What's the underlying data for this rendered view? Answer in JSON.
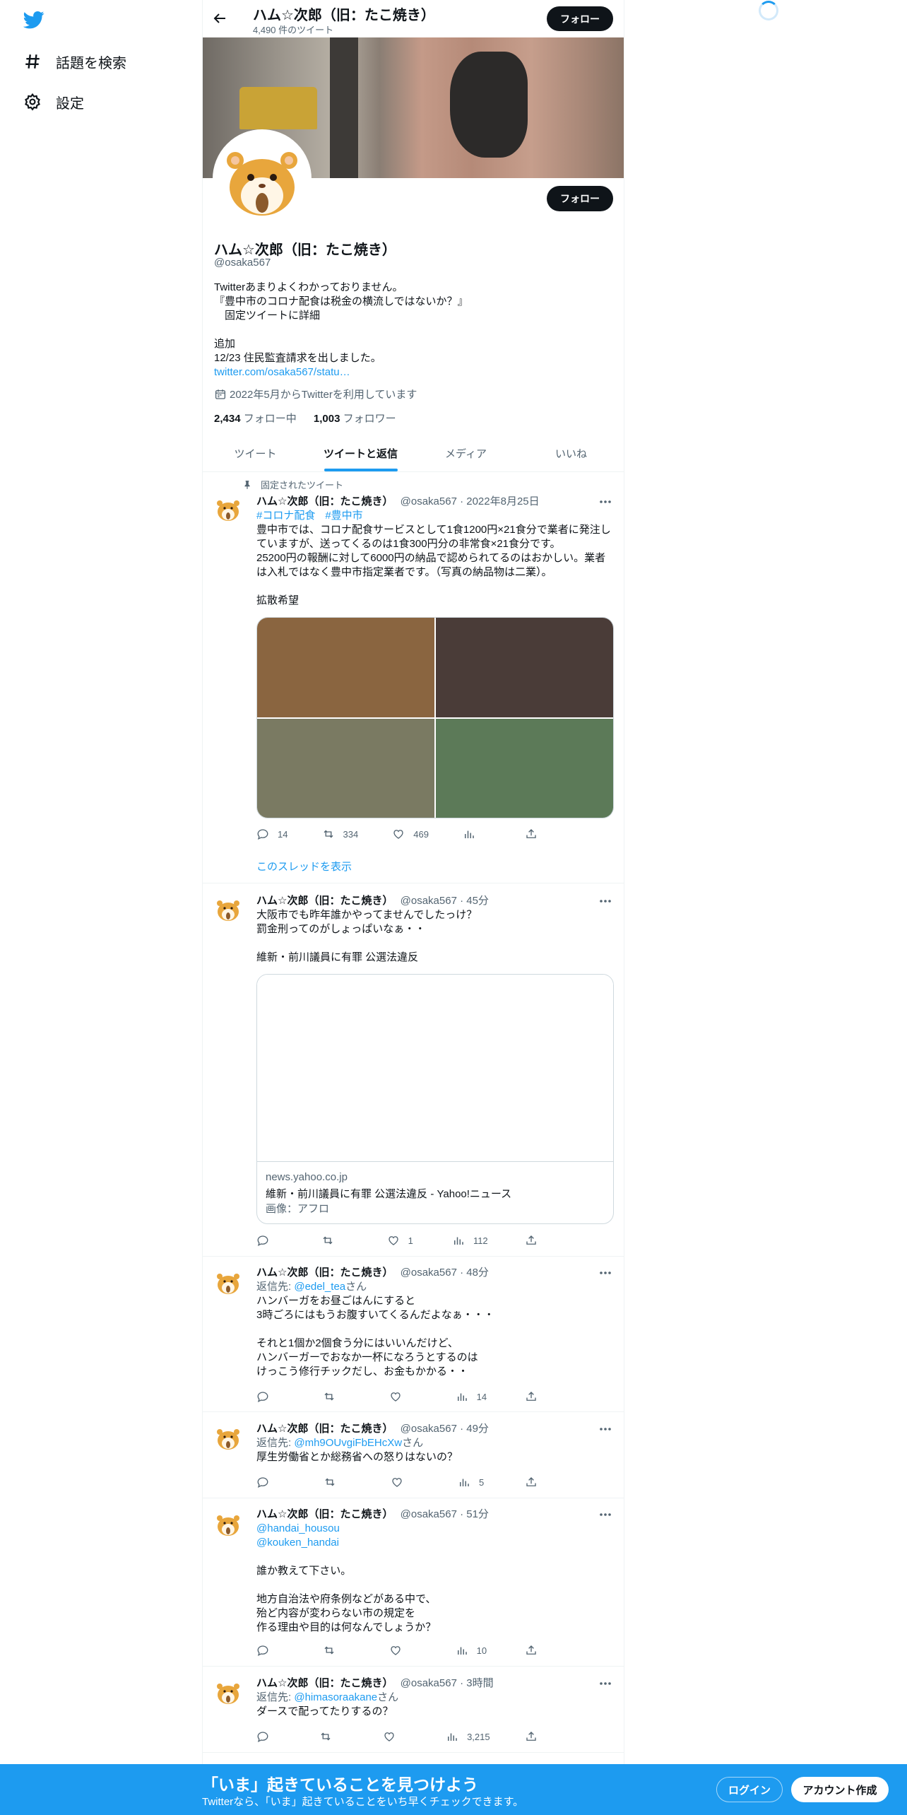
{
  "nav": {
    "explore_label": "話題を検索",
    "settings_label": "設定"
  },
  "header": {
    "name": "ハム☆次郎（旧：たこ焼き）",
    "tweet_count": "4,490 件のツイート",
    "follow_label": "フォロー"
  },
  "profile": {
    "name": "ハム☆次郎（旧：たこ焼き）",
    "handle": "@osaka567",
    "follow_label": "フォロー",
    "bio": [
      "Twitterあまりよくわかっておりません。",
      "『豊中市のコロナ配食は税金の横流しではないか？』",
      "　固定ツイートに詳細",
      "",
      "追加",
      "12/23 住民監査請求を出しました。"
    ],
    "bio_link": "twitter.com/osaka567/statu…",
    "joined": "2022年5月からTwitterを利用しています",
    "following_count": "2,434",
    "following_label": " フォロー中",
    "followers_count": "1,003",
    "followers_label": " フォロワー"
  },
  "tabs": [
    "ツイート",
    "ツイートと返信",
    "メディア",
    "いいね"
  ],
  "pinned": {
    "label": "固定されたツイート",
    "name": "ハム☆次郎（旧：たこ焼き）",
    "meta": "@osaka567 · 2022年8月25日",
    "hashtags": [
      "#コロナ配食",
      "#豊中市"
    ],
    "body": [
      "豊中市では、コロナ配食サービスとして1食1200円×21食分で業者に発注し",
      "ていますが、送ってくるのは1食300円分の非常食×21食分です。",
      "25200円の報酬に対して6000円の納品で認められてるのはおかしい。業者",
      "は入札ではなく豊中市指定業者です。（写真の納品物は二業）。",
      "",
      "拡散希望"
    ],
    "media_colors": [
      "#8a6540",
      "#4a3c38",
      "#7a7a62",
      "#5c7a58"
    ],
    "replies": "14",
    "retweets": "334",
    "likes": "469",
    "thread_link": "このスレッドを表示"
  },
  "tweets": [
    {
      "name": "ハム☆次郎（旧：たこ焼き）",
      "meta": "@osaka567 · 45分",
      "body": [
        "大阪市でも昨年誰かやってませんでしたっけ？",
        "罰金刑ってのがしょっぱいなぁ・・",
        "",
        "維新・前川議員に有罪 公選法違反"
      ],
      "card_domain": "news.yahoo.co.jp",
      "card_title": "維新・前川議員に有罪 公選法違反 - Yahoo!ニュース",
      "card_desc": "画像：アフロ",
      "likes": "1",
      "views": "112"
    },
    {
      "name": "ハム☆次郎（旧：たこ焼き）",
      "meta": "@osaka567 · 48分",
      "reply_prefix": "返信先: ",
      "reply_to": "@edel_tea",
      "reply_suffix": "さん",
      "body": [
        "ハンバーガをお昼ごはんにすると",
        "3時ごろにはもうお腹すいてくるんだよなぁ・・・",
        "",
        "それと1個か2個食う分にはいいんだけど、",
        "ハンバーガーでおなか一杯になろうとするのは",
        "けっこう修行チックだし、お金もかかる・・"
      ],
      "views": "14"
    },
    {
      "name": "ハム☆次郎（旧：たこ焼き）",
      "meta": "@osaka567 · 49分",
      "reply_prefix": "返信先: ",
      "reply_to": "@mh9OUvgiFbEHcXw",
      "reply_suffix": "さん",
      "body": [
        "厚生労働省とか総務省への怒りはないの？"
      ],
      "views": "5"
    },
    {
      "name": "ハム☆次郎（旧：たこ焼き）",
      "meta": "@osaka567 · 51分",
      "mentions": [
        "@handai_housou",
        "@kouken_handai"
      ],
      "body": [
        "",
        "誰か教えて下さい。",
        "",
        "地方自治法や府条例などがある中で、",
        "殆ど内容が変わらない市の規定を",
        "作る理由や目的は何なんでしょうか？"
      ],
      "views": "10"
    },
    {
      "name": "ハム☆次郎（旧：たこ焼き）",
      "meta": "@osaka567 · 3時間",
      "reply_prefix": "返信先: ",
      "reply_to": "@himasoraakane",
      "reply_suffix": "さん",
      "body": [
        "ダースで配ってたりするの？"
      ],
      "views": "3,215"
    }
  ],
  "bottombar": {
    "title": "「いま」起きていることを見つけよう",
    "subtitle": "Twitterなら、「いま」起きていることをいち早くチェックできます。",
    "login": "ログイン",
    "signup": "アカウント作成"
  },
  "colors": {
    "accent": "#1d9bf0",
    "text": "#0f1419",
    "secondary": "#536471"
  }
}
